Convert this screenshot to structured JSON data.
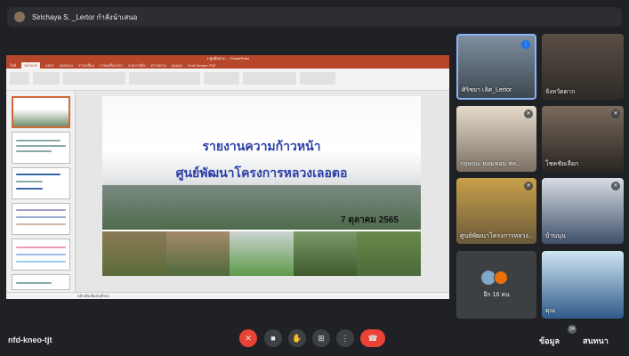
{
  "presenter_bar": {
    "text": "Sirichaya S. _Lertor กำลังนำเสนอ"
  },
  "presentation": {
    "window_title": "1 ศูนย์หลวง... - PowerPoint",
    "menu_tabs": [
      "ไฟล์",
      "หน้าแรก",
      "แทรก",
      "ออกแบบ",
      "การเปลี่ยน",
      "ภาพเคลื่อนไหว",
      "ฉายภาพนิ่ง",
      "ตรวจทาน",
      "มุมมอง",
      "Foxit Reader PDF"
    ],
    "slide": {
      "title_line1": "รายงานความก้าวหน้า",
      "title_line2": "ศูนย์พัฒนาโครงการหลวงเลอตอ",
      "date": "7 ตุลาคม  2565"
    },
    "notes_hint": "คลิกเพื่อเพิ่มบันทึกย่อ"
  },
  "participants": [
    {
      "name": "ศิริชยา เลิศ_Lertor"
    },
    {
      "name": "จังหวัดตาก"
    },
    {
      "name": "กฤษณะ หอมหอม สห..."
    },
    {
      "name": "โชคชัยเลือก"
    },
    {
      "name": "ศูนย์พัฒนาโครงการหลวง..."
    },
    {
      "name": "บ้านนุน"
    },
    {
      "name": "อีก 16 คน"
    },
    {
      "name": "คุณ"
    }
  ],
  "bottom_bar": {
    "meeting_code": "nfd-kneo-tjt",
    "right_label_1": "ข้อมูล",
    "right_label_2": "สนทนา",
    "participant_count": "24"
  },
  "icons": {
    "mic_off": "mic-off-icon",
    "camera": "camera-icon",
    "raise_hand": "hand-icon",
    "present": "present-icon",
    "more": "more-icon",
    "end_call": "end-call-icon"
  },
  "colors": {
    "end_call": "#ea4335",
    "slide_title": "#2b3ea8",
    "ppt_accent": "#b7472a"
  }
}
